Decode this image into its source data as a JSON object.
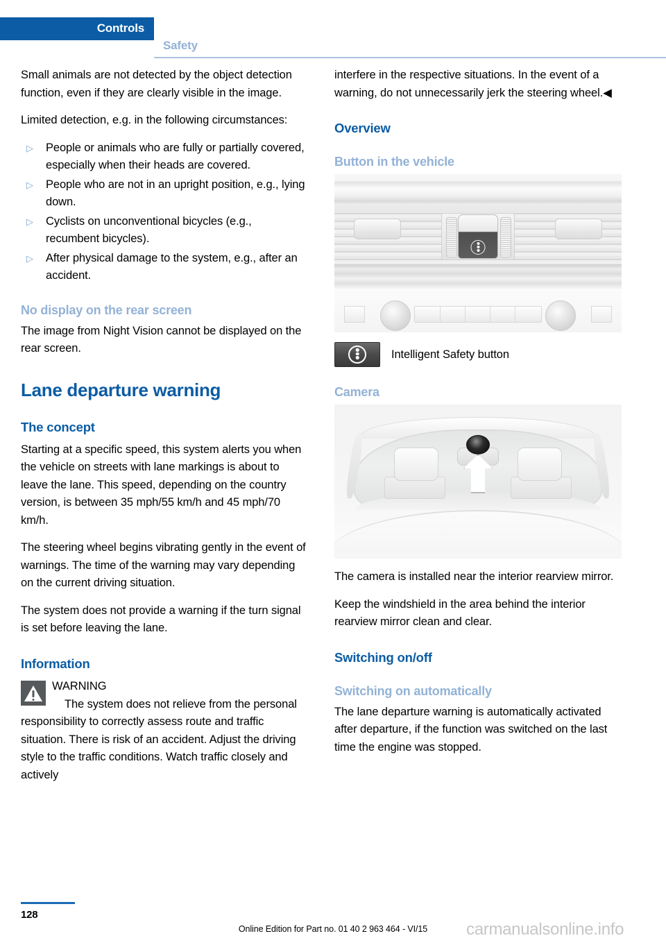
{
  "header": {
    "active_tab": "Controls",
    "inactive_tab": "Safety"
  },
  "left_column": {
    "para_1": "Small animals are not detected by the object detection function, even if they are clearly visible in the image.",
    "para_2": "Limited detection, e.g. in the following circumstances:",
    "bullet_marker": "▷",
    "bullets": [
      "People or animals who are fully or partially covered, especially when their heads are covered.",
      "People who are not in an upright position, e.g., lying down.",
      "Cyclists on unconventional bicycles (e.g., recumbent bicycles).",
      "After physical damage to the system, e.g., after an accident."
    ],
    "heading_no_display": "No display on the rear screen",
    "para_3": "The image from Night Vision cannot be displayed on the rear screen.",
    "heading_lane_departure": "Lane departure warning",
    "heading_the_concept": "The concept",
    "para_4": "Starting at a specific speed, this system alerts you when the vehicle on streets with lane markings is about to leave the lane. This speed, depending on the country version, is between 35 mph/55 km/h and 45 mph/70 km/h.",
    "para_5": "The steering wheel begins vibrating gently in the event of warnings. The time of the warning may vary depending on the current driving situation.",
    "para_6": "The system does not provide a warning if the turn signal is set before leaving the lane.",
    "heading_information": "Information",
    "warning_title": "WARNING",
    "warning_text": "The system does not relieve from the personal responsibility to correctly assess route and traffic situation. There is risk of an accident. Adjust the driving style to the traffic conditions. Watch traffic closely and actively"
  },
  "right_column": {
    "para_1": "interfere in the respective situations. In the event of a warning, do not unnecessarily jerk the steering wheel.◀",
    "heading_overview": "Overview",
    "heading_button_in_vehicle": "Button in the vehicle",
    "figure_dashboard_alt": "Dashboard center console with Intelligent Safety button",
    "icon_caption": "Intelligent Safety button",
    "heading_camera": "Camera",
    "figure_windshield_alt": "Windshield interior view with camera near rearview mirror",
    "para_2": "The camera is installed near the interior rearview mirror.",
    "para_3": "Keep the windshield in the area behind the interior rearview mirror clean and clear.",
    "heading_switching_on_off": "Switching on/off",
    "heading_switching_on_automatically": "Switching on automatically",
    "para_4": "The lane departure warning is automatically activated after departure, if the function was switched on the last time the engine was stopped."
  },
  "footer": {
    "page_number": "128",
    "edition_text": "Online Edition for Part no. 01 40 2 963 464 - VI/15",
    "watermark": "carmanualsonline.info"
  },
  "colors": {
    "brand_blue": "#0b5ca4",
    "light_blue": "#93b2d6",
    "rule_blue": "#aac4e0",
    "warning_gray": "#55595b"
  }
}
